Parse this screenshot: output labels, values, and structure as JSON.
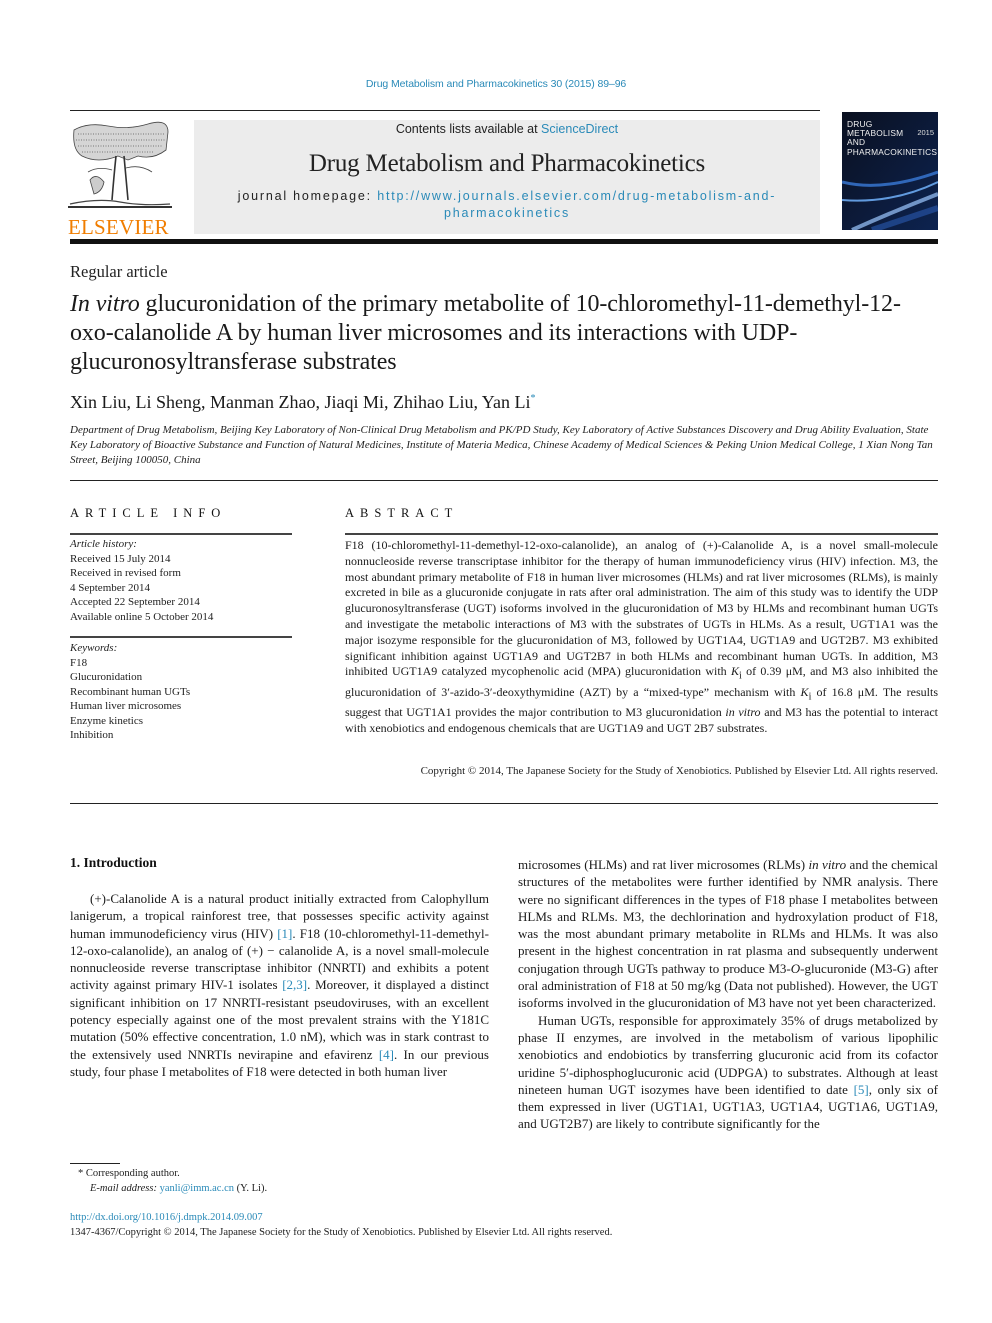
{
  "running_head": "Drug Metabolism and Pharmacokinetics 30 (2015) 89–96",
  "masthead": {
    "publisher_logo": "ELSEVIER",
    "contents_prefix": "Contents lists available at ",
    "contents_link": "ScienceDirect",
    "journal_title": "Drug Metabolism and Pharmacokinetics",
    "homepage_prefix": "journal homepage: ",
    "homepage_url_line1": "http://www.journals.elsevier.com/drug-metabolism-and-",
    "homepage_url_line2": "pharmacokinetics",
    "cover_title_lines": [
      "DRUG",
      "METABOLISM",
      "AND",
      "PHARMACOKINETICS"
    ],
    "cover_year": "2015"
  },
  "article": {
    "type": "Regular article",
    "title_italic": "In vitro",
    "title_rest": " glucuronidation of the primary metabolite of 10-chloromethyl-11-demethyl-12-oxo-calanolide A by human liver microsomes and its interactions with UDP-glucuronosyltransferase substrates",
    "authors": "Xin Liu, Li Sheng, Manman Zhao, Jiaqi Mi, Zhihao Liu, Yan Li",
    "corresponding_mark": "*",
    "affiliation": "Department of Drug Metabolism, Beijing Key Laboratory of Non-Clinical Drug Metabolism and PK/PD Study, Key Laboratory of Active Substances Discovery and Drug Ability Evaluation, State Key Laboratory of Bioactive Substance and Function of Natural Medicines, Institute of Materia Medica, Chinese Academy of Medical Sciences & Peking Union Medical College, 1 Xian Nong Tan Street, Beijing 100050, China"
  },
  "article_info": {
    "heading": "ARTICLE INFO",
    "history_label": "Article history:",
    "history": [
      "Received 15 July 2014",
      "Received in revised form",
      "4 September 2014",
      "Accepted 22 September 2014",
      "Available online 5 October 2014"
    ],
    "keywords_label": "Keywords:",
    "keywords": [
      "F18",
      "Glucuronidation",
      "Recombinant human UGTs",
      "Human liver microsomes",
      "Enzyme kinetics",
      "Inhibition"
    ]
  },
  "abstract": {
    "heading": "ABSTRACT",
    "part1": "F18 (10-chloromethyl-11-demethyl-12-oxo-calanolide), an analog of (+)-Calanolide A, is a novel small-molecule nonnucleoside reverse transcriptase inhibitor for the therapy of human immunodeficiency virus (HIV) infection. M3, the most abundant primary metabolite of F18 in human liver microsomes (HLMs) and rat liver microsomes (RLMs), is mainly excreted in bile as a glucuronide conjugate in rats after oral administration. The aim of this study was to identify the UDP glucuronosyltransferase (UGT) isoforms involved in the glucuronidation of M3 by HLMs and recombinant human UGTs and investigate the metabolic interactions of M3 with the substrates of UGTs in HLMs. As a result, UGT1A1 was the major isozyme responsible for the glucuronidation of M3, followed by UGT1A4, UGT1A9 and UGT2B7. M3 exhibited significant inhibition against UGT1A9 and UGT2B7 in both HLMs and recombinant human UGTs. In addition, M3 inhibited UGT1A9 catalyzed mycophenolic acid (MPA) glucuronidation with ",
    "ki_symbol": "K",
    "ki_sub": "i",
    "part2": " of 0.39 μM, and M3 also inhibited the glucuronidation of 3′-azido-3′-deoxythymidine (AZT) by a “mixed-type” mechanism with ",
    "part3": " of 16.8 μM. The results suggest that UGT1A1 provides the major contribution to M3 glucuronidation ",
    "in_vitro": "in vitro",
    "part4": " and M3 has the potential to interact with xenobiotics and endogenous chemicals that are UGT1A9 and UGT 2B7 substrates.",
    "copyright": "Copyright © 2014, The Japanese Society for the Study of Xenobiotics. Published by Elsevier Ltd. All rights reserved."
  },
  "introduction": {
    "heading": "1. Introduction",
    "left_p1_a": "(+)-Calanolide A is a natural product initially extracted from Calophyllum lanigerum, a tropical rainforest tree, that possesses specific activity against human immunodeficiency virus (HIV) ",
    "ref1": "[1]",
    "left_p1_b": ". F18 (10-chloromethyl-11-demethyl-12-oxo-calanolide), an analog of (+) − calanolide A, is a novel small-molecule nonnucleoside reverse transcriptase inhibitor (NNRTI) and exhibits a potent activity against primary HIV-1 isolates ",
    "ref23": "[2,3]",
    "left_p1_c": ". Moreover, it displayed a distinct significant inhibition on 17 NNRTI-resistant pseudoviruses, with an excellent potency especially against one of the most prevalent strains with the Y181C mutation (50% effective concentration, 1.0 nM), which was in stark contrast to the extensively used NNRTIs nevirapine and efavirenz ",
    "ref4": "[4]",
    "left_p1_d": ". In our previous study, four phase I metabolites of F18 were detected in both human liver",
    "right_p1_a": "microsomes (HLMs) and rat liver microsomes (RLMs) ",
    "right_in_vitro": "in vitro",
    "right_p1_b": " and the chemical structures of the metabolites were further identified by NMR analysis. There were no significant differences in the types of F18 phase I metabolites between HLMs and RLMs. M3, the dechlorination and hydroxylation product of F18, was the most abundant primary metabolite in RLMs and HLMs. It was also present in the highest concentration in rat plasma and subsequently underwent conjugation through UGTs pathway to produce M3-",
    "right_o": "O",
    "right_p1_c": "-glucuronide (M3-G) after oral administration of F18 at 50 mg/kg (Data not published). However, the UGT isoforms involved in the glucuronidation of M3 have not yet been characterized.",
    "right_p2_a": "Human UGTs, responsible for approximately 35% of drugs metabolized by phase II enzymes, are involved in the metabolism of various lipophilic xenobiotics and endobiotics by transferring glucuronic acid from its cofactor uridine 5′-diphosphoglucuronic acid (UDPGA) to substrates. Although at least nineteen human UGT isozymes have been identified to date ",
    "ref5": "[5]",
    "right_p2_b": ", only six of them expressed in liver (UGT1A1, UGT1A3, UGT1A4, UGT1A6, UGT1A9, and UGT2B7) are likely to contribute significantly for the"
  },
  "footnote": {
    "corresponding": "* Corresponding author.",
    "email_label": "E-mail address: ",
    "email": "yanli@imm.ac.cn",
    "email_suffix": " (Y. Li)."
  },
  "doi": "http://dx.doi.org/10.1016/j.dmpk.2014.09.007",
  "issn_line": "1347-4367/Copyright © 2014, The Japanese Society for the Study of Xenobiotics. Published by Elsevier Ltd. All rights reserved.",
  "colors": {
    "link": "#2a8ab8",
    "elsevier_orange": "#f07d00",
    "masthead_bg": "#ececec"
  }
}
